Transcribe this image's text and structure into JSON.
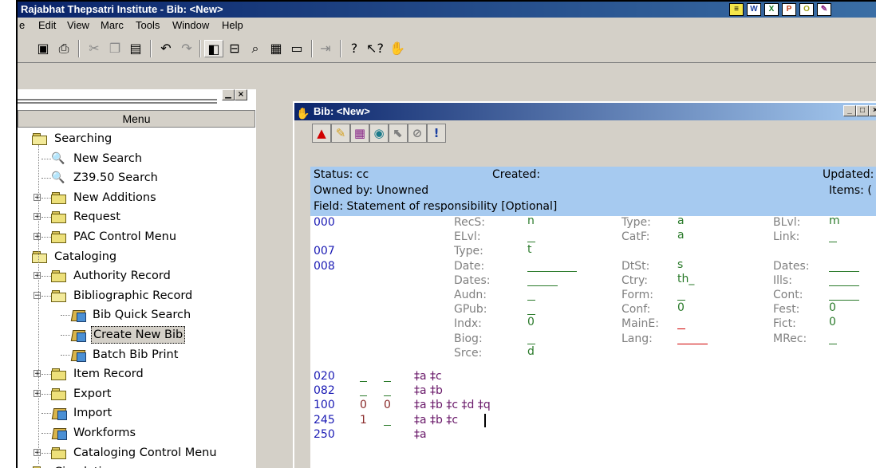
{
  "app": {
    "title": "Rajabhat Thepsatri Institute - Bib: <New>"
  },
  "menubar": {
    "items": [
      "e",
      "Edit",
      "View",
      "Marc",
      "Tools",
      "Window",
      "Help"
    ]
  },
  "toolbar": {
    "icons": [
      "save-icon",
      "print-icon",
      "cut-icon",
      "copy-icon",
      "paste-icon",
      "undo-icon",
      "redo-icon",
      "tile-icon",
      "cascade-icon",
      "find-icon",
      "spell-icon",
      "window-icon",
      "exit-icon",
      "help-icon",
      "whats-this-icon",
      "bib-icon"
    ]
  },
  "leftpane": {
    "header": "Menu",
    "tree": [
      {
        "label": "Searching",
        "level": 0,
        "icon": "folder-open"
      },
      {
        "label": "New Search",
        "level": 1,
        "icon": "key"
      },
      {
        "label": "Z39.50 Search",
        "level": 1,
        "icon": "key"
      },
      {
        "label": "New Additions",
        "level": 1,
        "icon": "folder",
        "expand": "+"
      },
      {
        "label": "Request",
        "level": 1,
        "icon": "folder",
        "expand": "+"
      },
      {
        "label": "PAC Control Menu",
        "level": 1,
        "icon": "folder",
        "expand": "+"
      },
      {
        "label": "Cataloging",
        "level": 0,
        "icon": "folder-open"
      },
      {
        "label": "Authority Record",
        "level": 1,
        "icon": "folder",
        "expand": "+"
      },
      {
        "label": "Bibliographic Record",
        "level": 1,
        "icon": "folder-open",
        "expand": "-"
      },
      {
        "label": "Bib Quick Search",
        "level": 2,
        "icon": "book"
      },
      {
        "label": "Create New Bib",
        "level": 2,
        "icon": "book",
        "selected": true
      },
      {
        "label": "Batch Bib Print",
        "level": 2,
        "icon": "book"
      },
      {
        "label": "Item Record",
        "level": 1,
        "icon": "folder",
        "expand": "+"
      },
      {
        "label": "Export",
        "level": 1,
        "icon": "folder",
        "expand": "+"
      },
      {
        "label": "Import",
        "level": 1,
        "icon": "book"
      },
      {
        "label": "Workforms",
        "level": 1,
        "icon": "book"
      },
      {
        "label": "Cataloging Control Menu",
        "level": 1,
        "icon": "folder",
        "expand": "+"
      },
      {
        "label": "Circulation",
        "level": 0,
        "icon": "folder"
      }
    ]
  },
  "child": {
    "title": "Bib: <New>",
    "info": {
      "status": "Status: cc",
      "created": "Created:",
      "updated": "Updated:",
      "owned": "Owned by: Unowned",
      "items": "Items: (",
      "field": "Field: Statement of responsibility [Optional]"
    },
    "fixed": [
      {
        "tag": "000",
        "row": 0
      },
      {
        "tag": "007",
        "row": 2
      },
      {
        "tag": "008",
        "row": 3
      }
    ],
    "fields": [
      {
        "l": "RecS:",
        "v": "n",
        "col": 0,
        "row": 0
      },
      {
        "l": "Type:",
        "v": "a",
        "col": 1,
        "row": 0
      },
      {
        "l": "BLvl:",
        "v": "m",
        "col": 2,
        "row": 0
      },
      {
        "l": "ELvl:",
        "v": "_",
        "col": 0,
        "row": 1
      },
      {
        "l": "CatF:",
        "v": "a",
        "col": 1,
        "row": 1
      },
      {
        "l": "Link:",
        "v": "_",
        "col": 2,
        "row": 1
      },
      {
        "l": "Type:",
        "v": "t",
        "col": 0,
        "row": 2
      },
      {
        "l": "Date:",
        "v": "",
        "col": 0,
        "row": 3,
        "blank": "long"
      },
      {
        "l": "DtSt:",
        "v": "s",
        "col": 1,
        "row": 3
      },
      {
        "l": "Dates:",
        "v": "",
        "col": 2,
        "row": 3,
        "blank": "short"
      },
      {
        "l": "Dates:",
        "v": "",
        "col": 0,
        "row": 4,
        "blank": "short"
      },
      {
        "l": "Ctry:",
        "v": "th_",
        "col": 1,
        "row": 4
      },
      {
        "l": "Ills:",
        "v": "",
        "col": 2,
        "row": 4,
        "blank": "short"
      },
      {
        "l": "Audn:",
        "v": "_",
        "col": 0,
        "row": 5
      },
      {
        "l": "Form:",
        "v": "_",
        "col": 1,
        "row": 5
      },
      {
        "l": "Cont:",
        "v": "",
        "col": 2,
        "row": 5,
        "blank": "short"
      },
      {
        "l": "GPub:",
        "v": "_",
        "col": 0,
        "row": 6
      },
      {
        "l": "Conf:",
        "v": "0",
        "col": 1,
        "row": 6
      },
      {
        "l": "Fest:",
        "v": "0",
        "col": 2,
        "row": 6
      },
      {
        "l": "Indx:",
        "v": "0",
        "col": 0,
        "row": 7
      },
      {
        "l": "MainE:",
        "v": "_",
        "col": 1,
        "row": 7,
        "red": true
      },
      {
        "l": "Fict:",
        "v": "0",
        "col": 2,
        "row": 7
      },
      {
        "l": "Biog:",
        "v": "_",
        "col": 0,
        "row": 8
      },
      {
        "l": "Lang:",
        "v": "",
        "col": 1,
        "row": 8,
        "blank": "red"
      },
      {
        "l": "MRec:",
        "v": "_",
        "col": 2,
        "row": 8
      },
      {
        "l": "Srce:",
        "v": "d",
        "col": 0,
        "row": 9
      }
    ],
    "varfields": [
      {
        "tag": "020",
        "i1": "_",
        "i2": "_",
        "subs": "‡a ‡c"
      },
      {
        "tag": "082",
        "i1": "_",
        "i2": "_",
        "subs": "‡a ‡b"
      },
      {
        "tag": "100",
        "i1": "0",
        "i2": "0",
        "subs": "‡a ‡b ‡c ‡d ‡q"
      },
      {
        "tag": "245",
        "i1": "1",
        "i2": "_",
        "subs": "‡a ‡b ‡c"
      },
      {
        "tag": "250",
        "i1": "",
        "i2": "",
        "subs": "‡a"
      }
    ]
  }
}
